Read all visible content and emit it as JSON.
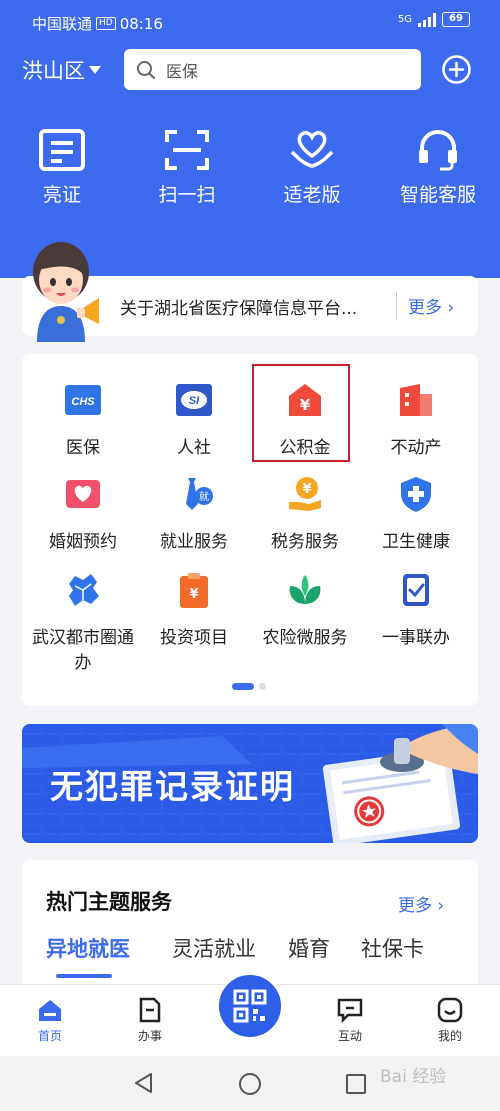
{
  "status_bar": {
    "carrier": "中国联通",
    "hd": "HD",
    "time": "08:16",
    "signal": "5G",
    "battery": "69"
  },
  "header": {
    "district": "洪山区",
    "search_value": "医保"
  },
  "quick_actions": [
    {
      "label": "亮证",
      "icon": "id-card-icon"
    },
    {
      "label": "扫一扫",
      "icon": "scan-icon"
    },
    {
      "label": "适老版",
      "icon": "elderly-heart-icon"
    },
    {
      "label": "智能客服",
      "icon": "headset-icon"
    }
  ],
  "notice": {
    "text": "关于湖北省医疗保障信息平台...",
    "more": "更多"
  },
  "services": [
    {
      "label": "医保",
      "icon": "chs-icon",
      "color": "#2f74e8"
    },
    {
      "label": "人社",
      "icon": "si-icon",
      "color": "#2f57c8"
    },
    {
      "label": "公积金",
      "icon": "housing-fund-icon",
      "color": "#ef4a3c"
    },
    {
      "label": "不动产",
      "icon": "building-icon",
      "color": "#ef4a3c"
    },
    {
      "label": "婚姻预约",
      "icon": "marriage-icon",
      "color": "#f0506a"
    },
    {
      "label": "就业服务",
      "icon": "employment-icon",
      "color": "#2f74e8"
    },
    {
      "label": "税务服务",
      "icon": "tax-icon",
      "color": "#f5a623"
    },
    {
      "label": "卫生健康",
      "icon": "health-cross-icon",
      "color": "#2f74e8"
    },
    {
      "label": "武汉都市圈通办",
      "icon": "map-icon",
      "color": "#2f74e8"
    },
    {
      "label": "投资项目",
      "icon": "investment-icon",
      "color": "#f26b2a"
    },
    {
      "label": "农险微服务",
      "icon": "sprout-icon",
      "color": "#1aa36a"
    },
    {
      "label": "一事联办",
      "icon": "checklist-icon",
      "color": "#2f57c8"
    }
  ],
  "banner": {
    "title": "无犯罪记录证明"
  },
  "topics": {
    "title": "热门主题服务",
    "more": "更多",
    "tabs": [
      "异地就医",
      "灵活就业",
      "婚育",
      "社保卡"
    ],
    "active_index": 0
  },
  "bottom_nav": [
    {
      "label": "首页",
      "icon": "home-icon",
      "active": true
    },
    {
      "label": "办事",
      "icon": "file-icon",
      "active": false
    },
    {
      "label": "互动",
      "icon": "chat-icon",
      "active": false
    },
    {
      "label": "我的",
      "icon": "smile-icon",
      "active": false
    }
  ],
  "watermark": "Bai 经验",
  "colors": {
    "primary": "#3c6bf0",
    "highlight": "#c8202a"
  }
}
